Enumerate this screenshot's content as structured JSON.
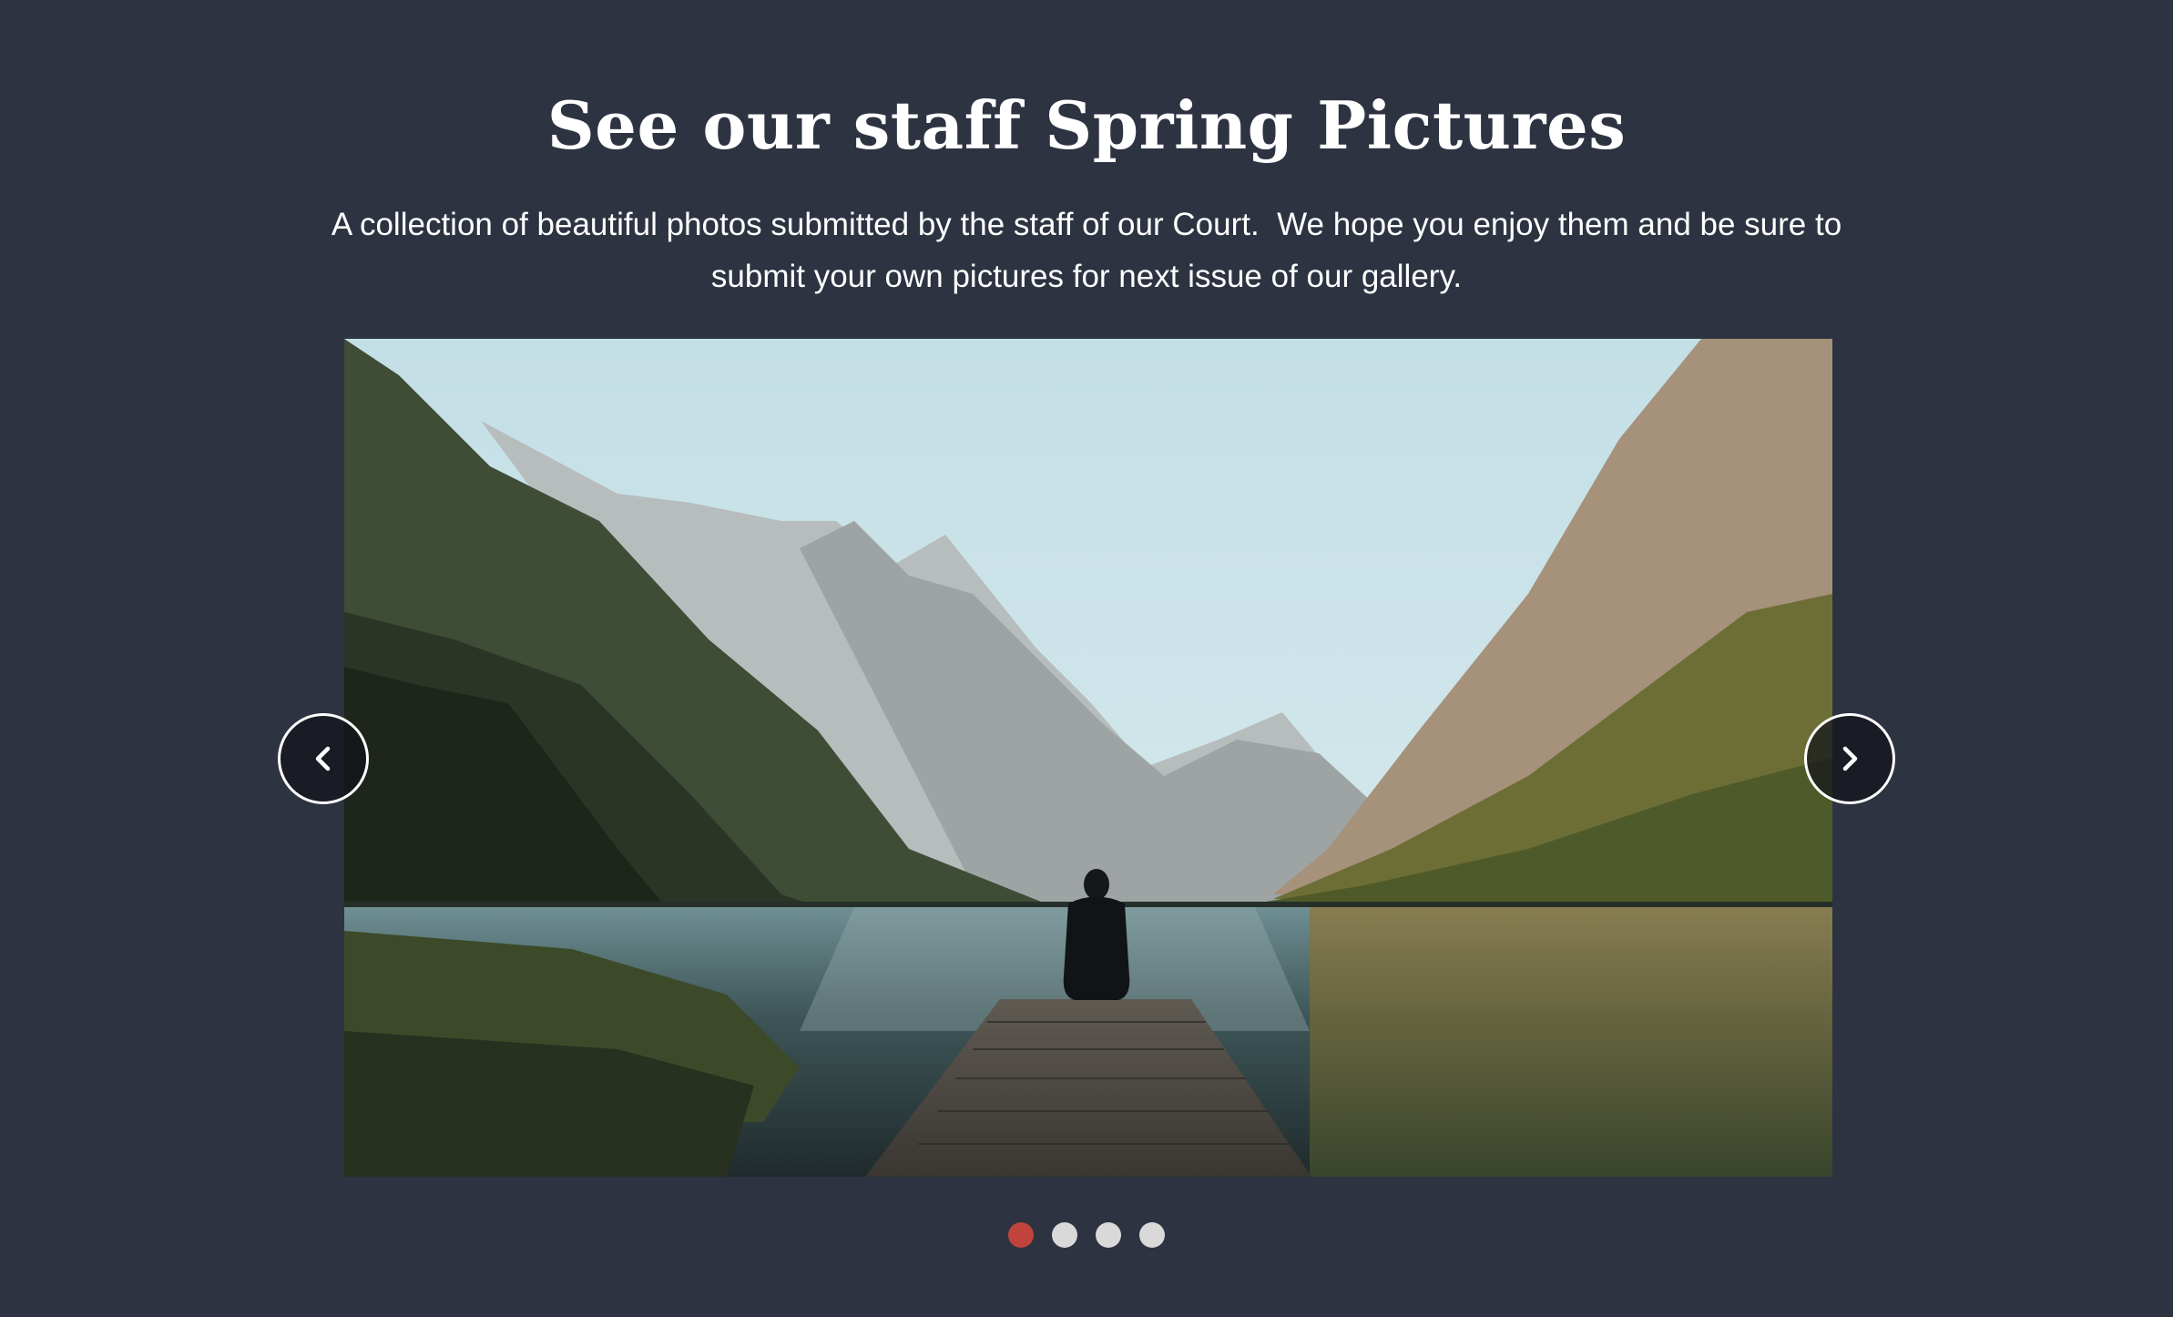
{
  "page": {
    "title": "See our staff Spring Pictures",
    "description": "A collection of beautiful photos submitted by the staff of our Court.  We hope you enjoy them and be sure to submit your own pictures for next issue of our gallery."
  },
  "carousel": {
    "slide_count": 4,
    "active_index": 0,
    "prev_icon": "chevron-left-icon",
    "next_icon": "chevron-right-icon",
    "active_dot_color": "#c0443c",
    "inactive_dot_color": "#d9d9d9"
  },
  "colors": {
    "background": "#2d3341",
    "text": "#ffffff"
  }
}
